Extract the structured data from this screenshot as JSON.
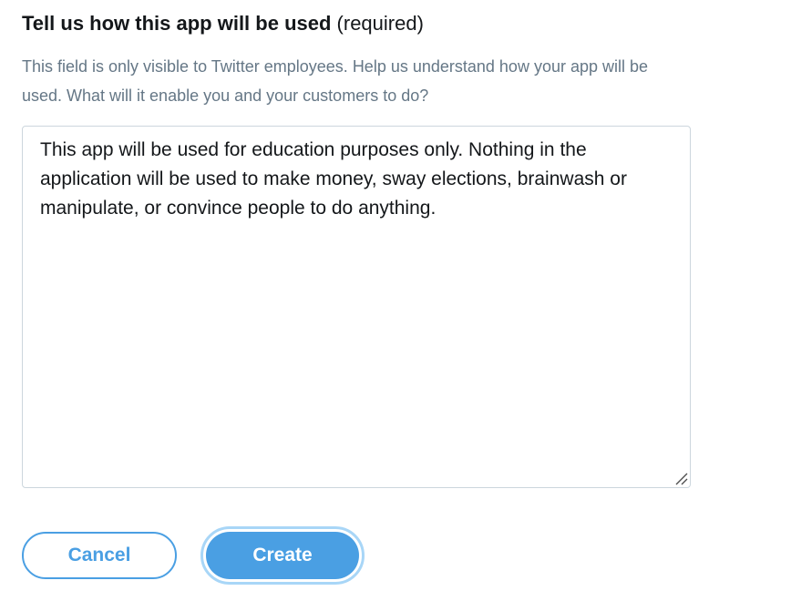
{
  "field": {
    "heading_title": "Tell us how this app will be used",
    "heading_required": "(required)",
    "help_text": "This field is only visible to Twitter employees. Help us understand how your app will be used. What will it enable you and your customers to do?",
    "value": "This app will be used for education purposes only. Nothing in the application will be used to make money, sway elections, brainwash or manipulate, or convince people to do anything."
  },
  "buttons": {
    "cancel_label": "Cancel",
    "create_label": "Create"
  },
  "colors": {
    "accent": "#4a9fe3",
    "focus_ring": "#a8d6f7",
    "help_text": "#657786",
    "textarea_border": "#ccd6dd"
  },
  "icons": {
    "resize_handle": "resize-handle-icon"
  }
}
